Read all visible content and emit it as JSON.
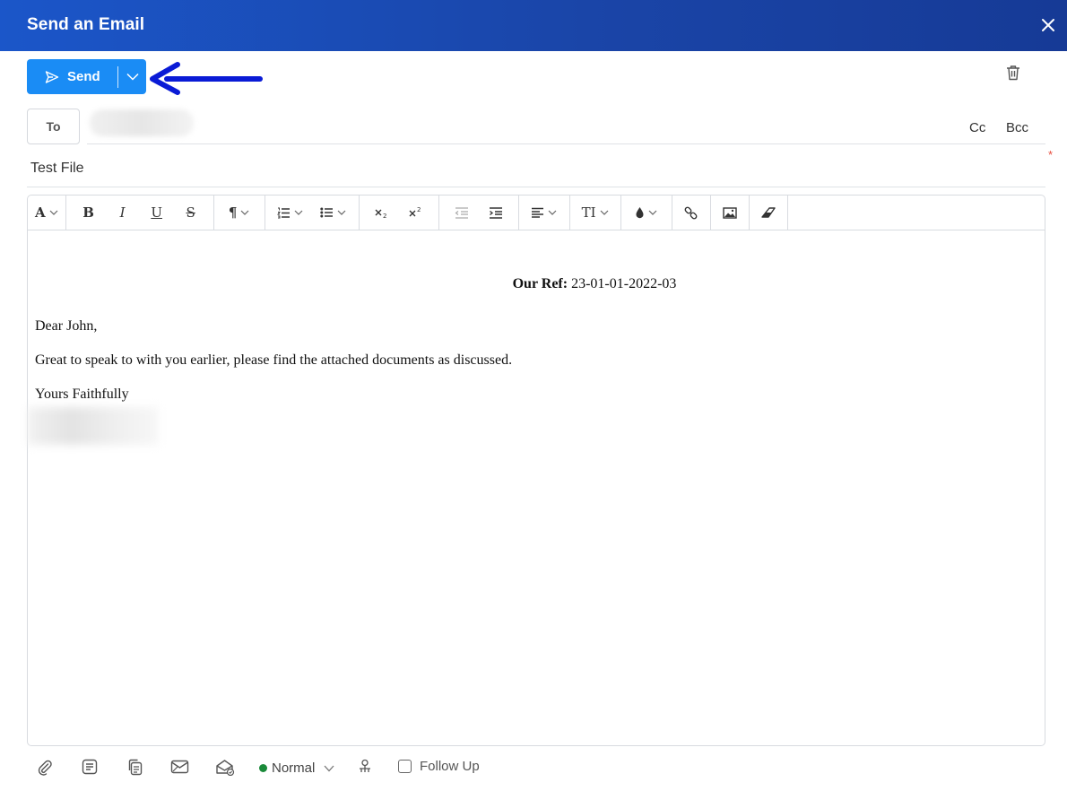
{
  "dialog": {
    "title": "Send an Email"
  },
  "compose": {
    "send_label": "Send",
    "to_label": "To",
    "cc_label": "Cc",
    "bcc_label": "Bcc",
    "required_mark": "*",
    "subject": "Test File"
  },
  "body": {
    "ref_label": "Our Ref:",
    "ref_value": "23-01-01-2022-03",
    "greeting": "Dear John,",
    "message": "Great to speak to with you earlier, please find the attached documents as discussed.",
    "closing": "Yours Faithfully"
  },
  "toolbar": {
    "font_glyph": "A",
    "bold_glyph": "B",
    "italic_glyph": "I",
    "underline_glyph": "U",
    "strike_glyph": "S",
    "paragraph_glyph": "¶",
    "text_size_glyph": "TI"
  },
  "footer": {
    "priority_label": "Normal",
    "follow_up_label": "Follow Up"
  },
  "colors": {
    "header_gradient_start": "#1b56c9",
    "header_gradient_end": "#163a96",
    "send_button": "#1a8cf5",
    "annotation_arrow": "#0a1bd6",
    "priority_dot": "#1a8a3a",
    "required_mark": "#e74c3c"
  },
  "icons": [
    "close-icon",
    "send-icon",
    "chevron-down-icon",
    "arrow-annotation",
    "trash-icon",
    "attach-icon",
    "template-icon",
    "copy-icon",
    "image-mail-icon",
    "read-receipt-icon",
    "assign-icon",
    "link-icon",
    "image-icon",
    "eraser-icon"
  ]
}
